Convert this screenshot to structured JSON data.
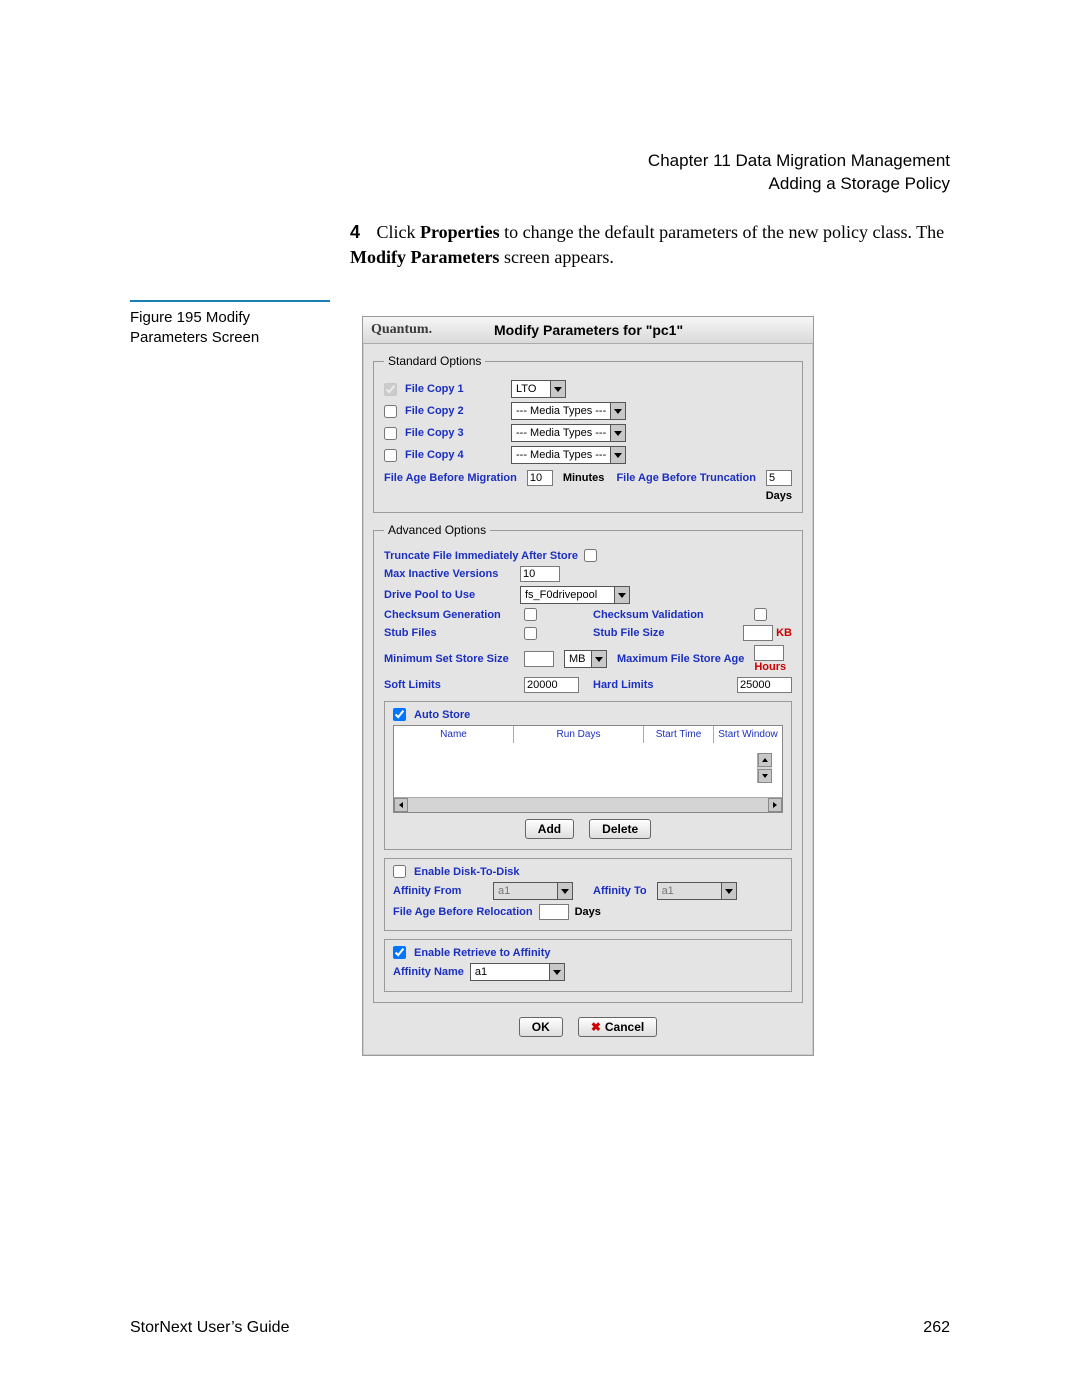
{
  "header": {
    "chapter": "Chapter 11  Data Migration Management",
    "section": "Adding a Storage Policy"
  },
  "step": {
    "number": "4",
    "pre": "Click ",
    "bold1": "Properties",
    "mid": " to change the default parameters of the new policy class. The ",
    "bold2": "Modify Parameters",
    "post": " screen appears."
  },
  "caption": {
    "text": "Figure 195  Modify Parameters Screen"
  },
  "dialog": {
    "brand": "Quantum.",
    "title": "Modify Parameters for \"pc1\"",
    "standard": {
      "legend": "Standard Options",
      "fc1": "File Copy 1",
      "fc2": "File Copy 2",
      "fc3": "File Copy 3",
      "fc4": "File Copy 4",
      "sel1": "LTO",
      "sel2": "--- Media Types ---",
      "sel3": "--- Media Types ---",
      "sel4": "--- Media Types ---",
      "fab_mig": "File Age Before Migration",
      "fab_mig_val": "10",
      "minutes": "Minutes",
      "fab_trunc": "File Age Before Truncation",
      "fab_trunc_val": "5",
      "days": "Days"
    },
    "advanced": {
      "legend": "Advanced Options",
      "trunc_after": "Truncate File Immediately After Store",
      "max_inactive": "Max Inactive Versions",
      "max_inactive_val": "10",
      "drive_pool": "Drive Pool to Use",
      "drive_pool_val": "fs_F0drivepool",
      "cksum_gen": "Checksum Generation",
      "cksum_val": "Checksum Validation",
      "stub_files": "Stub Files",
      "stub_size": "Stub File Size",
      "kb": "KB",
      "min_set": "Minimum Set Store Size",
      "mb": "MB",
      "max_age": "Maximum File Store Age",
      "hours": "Hours",
      "soft": "Soft Limits",
      "soft_val": "20000",
      "hard": "Hard Limits",
      "hard_val": "25000",
      "auto_store": "Auto Store",
      "th_name": "Name",
      "th_run": "Run Days",
      "th_start": "Start Time",
      "th_win": "Start Window",
      "add": "Add",
      "delete": "Delete",
      "enable_d2d": "Enable Disk-To-Disk",
      "aff_from": "Affinity From",
      "aff_to": "Affinity To",
      "aff_val": "a1",
      "fab_reloc": "File Age Before Relocation",
      "days2": "Days",
      "enable_ret": "Enable Retrieve to Affinity",
      "aff_name": "Affinity Name",
      "aff_name_val": "a1"
    },
    "ok": "OK",
    "cancel": "Cancel"
  },
  "footer": {
    "left": "StorNext User’s Guide",
    "right": "262"
  }
}
